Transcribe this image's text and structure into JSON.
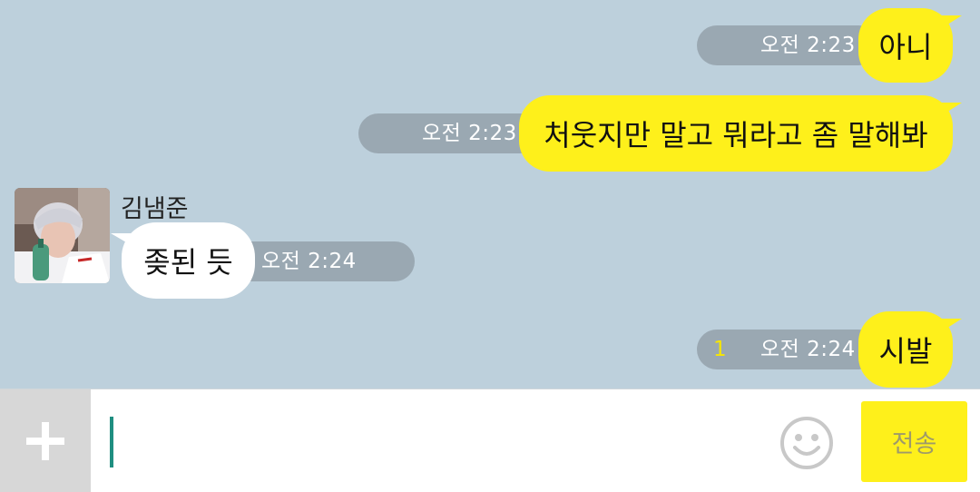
{
  "messages": [
    {
      "sender": "me",
      "text": "아니",
      "time": "오전 2:23"
    },
    {
      "sender": "me",
      "text": "처웃지만 말고 뭐라고 좀 말해봐",
      "time": "오전 2:23"
    },
    {
      "sender": "김냄준",
      "text": "좆된 듯",
      "time": "오전 2:24"
    },
    {
      "sender": "me",
      "text": "시발",
      "time": "오전 2:24",
      "unread": "1"
    }
  ],
  "input": {
    "placeholder": "",
    "value": ""
  },
  "composer": {
    "send_label": "전송",
    "plus_icon": "plus-icon",
    "emoticon_icon": "emoticon-icon"
  },
  "colors": {
    "background": "#bdd0dc",
    "my_bubble": "#fef01b",
    "their_bubble": "#ffffff",
    "time_pill": "#9aa8b2",
    "unread": "#f7e600",
    "cursor": "#1f8e80"
  }
}
